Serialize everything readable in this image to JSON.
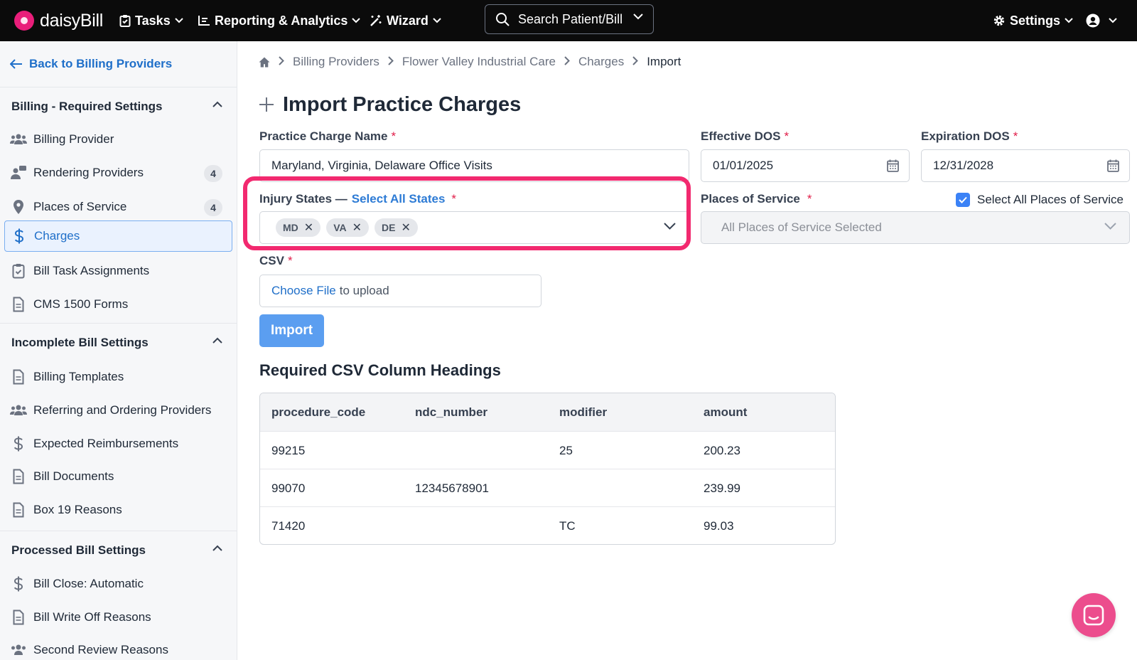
{
  "app": {
    "logo_text": "daisyBill"
  },
  "nav": {
    "tasks": "Tasks",
    "reporting": "Reporting & Analytics",
    "wizard": "Wizard",
    "search_label": "Search Patient/Bill",
    "settings": "Settings"
  },
  "sidebar": {
    "back_label": "Back to Billing Providers",
    "sections": [
      {
        "title": "Billing - Required Settings",
        "items": [
          {
            "label": "Billing Provider",
            "icon": "users-icon"
          },
          {
            "label": "Rendering Providers",
            "icon": "user-chat-icon",
            "count": "4"
          },
          {
            "label": "Places of Service",
            "icon": "map-pin-icon",
            "count": "4"
          },
          {
            "label": "Charges",
            "icon": "dollar-icon",
            "active": true
          },
          {
            "label": "Bill Task Assignments",
            "icon": "clipboard-check-icon"
          },
          {
            "label": "CMS 1500 Forms",
            "icon": "document-icon"
          }
        ]
      },
      {
        "title": "Incomplete Bill Settings",
        "items": [
          {
            "label": "Billing Templates",
            "icon": "document-icon"
          },
          {
            "label": "Referring and Ordering Providers",
            "icon": "users-icon"
          },
          {
            "label": "Expected Reimbursements",
            "icon": "dollar-icon"
          },
          {
            "label": "Bill Documents",
            "icon": "document-icon"
          },
          {
            "label": "Box 19 Reasons",
            "icon": "document-icon"
          }
        ]
      },
      {
        "title": "Processed Bill Settings",
        "items": [
          {
            "label": "Bill Close: Automatic",
            "icon": "dollar-icon"
          },
          {
            "label": "Bill Write Off Reasons",
            "icon": "document-icon"
          },
          {
            "label": "Second Review Reasons",
            "icon": "users-icon"
          }
        ]
      }
    ]
  },
  "breadcrumb": [
    "Billing Providers",
    "Flower Valley Industrial Care",
    "Charges",
    "Import"
  ],
  "page_title": "Import Practice Charges",
  "form": {
    "charge_name_label": "Practice Charge Name",
    "charge_name_value": "Maryland, Virginia, Delaware Office Visits",
    "effective_label": "Effective DOS",
    "effective_value": "01/01/2025",
    "expiration_label": "Expiration DOS",
    "expiration_value": "12/31/2028",
    "injury_label": "Injury States —",
    "select_all_states": "Select All States",
    "states": [
      "MD",
      "VA",
      "DE"
    ],
    "pos_label": "Places of Service",
    "select_all_pos": "Select All Places of Service",
    "select_all_pos_checked": true,
    "pos_value": "All Places of Service Selected",
    "csv_label": "CSV",
    "choose_file": "Choose File",
    "to_upload": "to upload",
    "import_button": "Import",
    "required_mark": "*"
  },
  "csv_section": {
    "title": "Required CSV Column Headings",
    "columns": [
      "procedure_code",
      "ndc_number",
      "modifier",
      "amount"
    ],
    "rows": [
      [
        "99215",
        "",
        "25",
        "200.23"
      ],
      [
        "99070",
        "12345678901",
        "",
        "239.99"
      ],
      [
        "71420",
        "",
        "TC",
        "99.03"
      ]
    ]
  },
  "colors": {
    "accent": "#1f6fc9",
    "highlight": "#f2296f",
    "brand": "#e91e7a",
    "chat": "#ec4d8d"
  }
}
